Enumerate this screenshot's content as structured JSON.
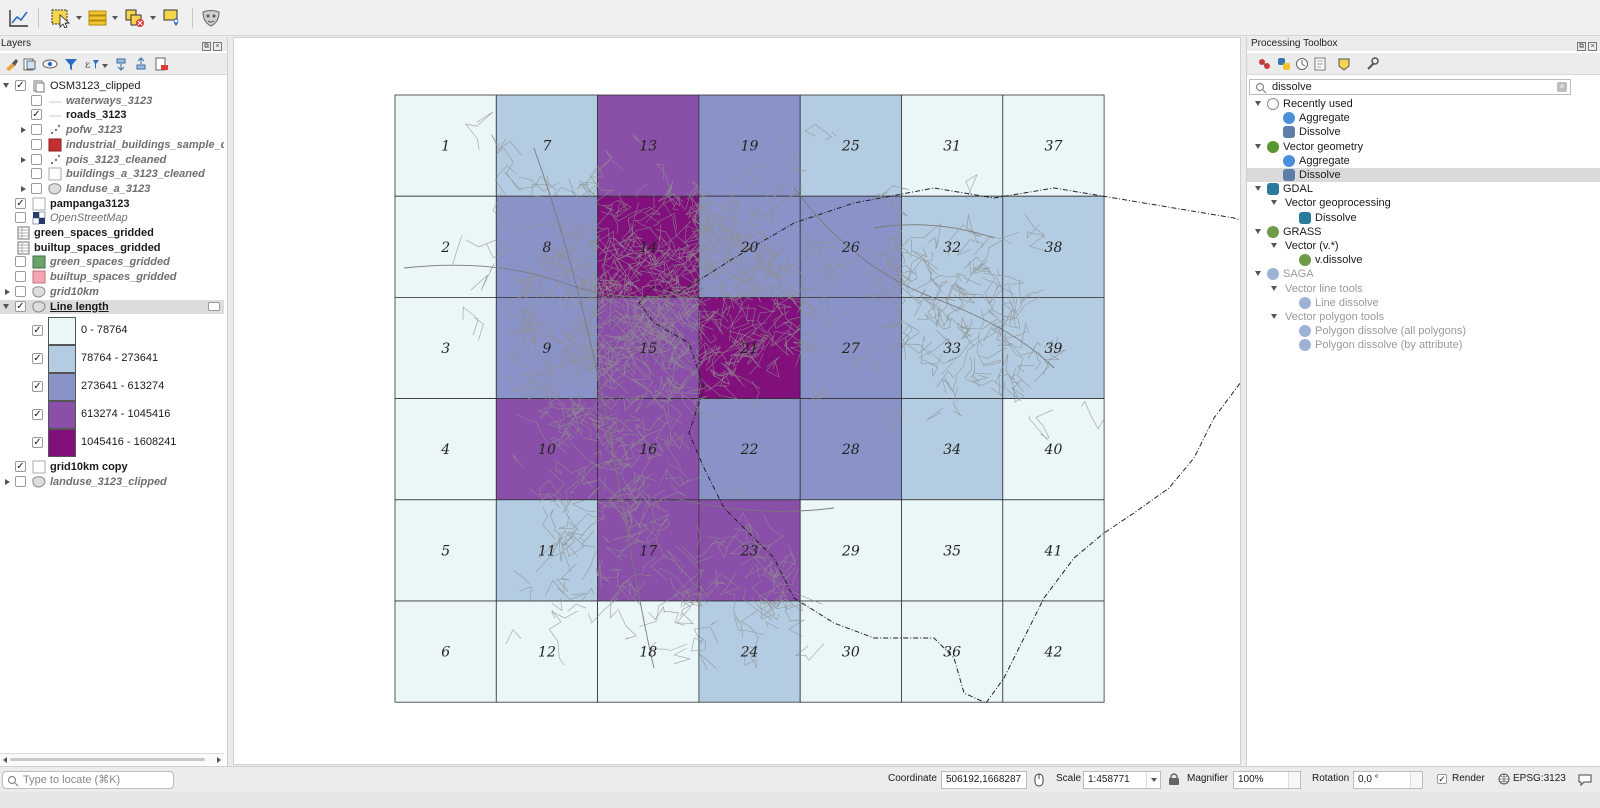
{
  "toolbar": {
    "icons": [
      "measure-graph-icon",
      "select-features-icon",
      "attribute-table-icon",
      "deselect-icon",
      "identify-icon",
      "plugin-mask-icon"
    ]
  },
  "layers": {
    "title": "Layers",
    "items": [
      {
        "name": "OSM3123_clipped",
        "checked": true,
        "style": "normal",
        "expand": "open",
        "indent": 0,
        "icon": "group-icon"
      },
      {
        "name": "waterways_3123",
        "checked": false,
        "style": "bi",
        "expand": "none",
        "indent": 1,
        "icon": "line-layer-icon"
      },
      {
        "name": "roads_3123",
        "checked": true,
        "style": "b",
        "expand": "none",
        "indent": 1,
        "icon": "line-layer-icon"
      },
      {
        "name": "pofw_3123",
        "checked": false,
        "style": "bi",
        "expand": "closed",
        "indent": 1,
        "icon": "point-layer-icon"
      },
      {
        "name": "industrial_buildings_sample_c",
        "checked": false,
        "style": "bi",
        "expand": "none",
        "indent": 1,
        "icon": "polygon-red-icon"
      },
      {
        "name": "pois_3123_cleaned",
        "checked": false,
        "style": "bi",
        "expand": "closed",
        "indent": 1,
        "icon": "point-layer-icon"
      },
      {
        "name": "buildings_a_3123_cleaned",
        "checked": false,
        "style": "bi",
        "expand": "none",
        "indent": 1,
        "icon": "polygon-white-icon"
      },
      {
        "name": "landuse_a_3123",
        "checked": false,
        "style": "bi",
        "expand": "closed",
        "indent": 1,
        "icon": "polygon-categorized-icon"
      },
      {
        "name": "pampanga3123",
        "checked": true,
        "style": "b",
        "expand": "none",
        "indent": 0,
        "icon": "polygon-white-icon"
      },
      {
        "name": "OpenStreetMap",
        "checked": false,
        "style": "i",
        "expand": "none",
        "indent": 0,
        "icon": "raster-tile-icon"
      },
      {
        "name": "green_spaces_gridded",
        "checked": null,
        "style": "b",
        "expand": "none",
        "indent": 0,
        "icon": "table-icon"
      },
      {
        "name": "builtup_spaces_gridded",
        "checked": null,
        "style": "b",
        "expand": "none",
        "indent": 0,
        "icon": "table-icon"
      },
      {
        "name": "green_spaces_gridded",
        "checked": false,
        "style": "bi",
        "expand": "none",
        "indent": 0,
        "icon": "polygon-green-icon"
      },
      {
        "name": "builtup_spaces_gridded",
        "checked": false,
        "style": "bi",
        "expand": "none",
        "indent": 0,
        "icon": "polygon-pink-icon"
      },
      {
        "name": "grid10km",
        "checked": false,
        "style": "bi",
        "expand": "closed",
        "indent": 0,
        "icon": "polygon-categorized-icon"
      },
      {
        "name": "Line length",
        "checked": true,
        "style": "u",
        "expand": "open",
        "indent": 0,
        "icon": "polygon-categorized-icon"
      }
    ],
    "legend": [
      {
        "label": "0 - 78764",
        "color": "#eaf6f8",
        "checked": true
      },
      {
        "label": "78764 - 273641",
        "color": "#b3cce1",
        "checked": true
      },
      {
        "label": "273641 - 613274",
        "color": "#8a93c8",
        "checked": true
      },
      {
        "label": "613274 - 1045416",
        "color": "#8a4fa8",
        "checked": true
      },
      {
        "label": "1045416 - 1608241",
        "color": "#810f7c",
        "checked": true
      }
    ],
    "items_after": [
      {
        "name": "grid10km copy",
        "checked": true,
        "style": "b",
        "expand": "none",
        "indent": 0,
        "icon": "polygon-white-icon"
      },
      {
        "name": "landuse_3123_clipped",
        "checked": false,
        "style": "bi",
        "expand": "closed",
        "indent": 0,
        "icon": "polygon-categorized-icon"
      }
    ]
  },
  "map": {
    "grid_columns": 7,
    "grid_rows": 6,
    "cell_ids": [
      [
        1,
        7,
        13,
        19,
        25,
        31,
        37
      ],
      [
        2,
        8,
        14,
        20,
        26,
        32,
        38
      ],
      [
        3,
        9,
        15,
        21,
        27,
        33,
        39
      ],
      [
        4,
        10,
        16,
        22,
        28,
        34,
        40
      ],
      [
        5,
        11,
        17,
        23,
        29,
        35,
        41
      ],
      [
        6,
        12,
        18,
        24,
        30,
        36,
        42
      ]
    ],
    "cell_class": [
      [
        0,
        1,
        3,
        2,
        1,
        0,
        0
      ],
      [
        0,
        2,
        4,
        2,
        2,
        1,
        1
      ],
      [
        0,
        2,
        3,
        4,
        2,
        1,
        1
      ],
      [
        0,
        3,
        3,
        2,
        2,
        1,
        0
      ],
      [
        0,
        1,
        3,
        3,
        0,
        0,
        0
      ],
      [
        0,
        0,
        0,
        1,
        0,
        0,
        0
      ]
    ],
    "class_colors": [
      "#eaf6f8",
      "#b3cce1",
      "#8a93c8",
      "#8a4fa8",
      "#810f7c"
    ]
  },
  "toolbox": {
    "title": "Processing Toolbox",
    "search_value": "dissolve",
    "items": [
      {
        "label": "Recently used",
        "level": 0,
        "expand": "open",
        "icon": "clock-icon",
        "dim": false,
        "selected": false
      },
      {
        "label": "Aggregate",
        "level": 1,
        "expand": "none",
        "icon": "gear-icon",
        "dim": false,
        "selected": false
      },
      {
        "label": "Dissolve",
        "level": 1,
        "expand": "none",
        "icon": "dissolve-icon",
        "dim": false,
        "selected": false
      },
      {
        "label": "Vector geometry",
        "level": 0,
        "expand": "open",
        "icon": "qgis-icon",
        "dim": false,
        "selected": false
      },
      {
        "label": "Aggregate",
        "level": 1,
        "expand": "none",
        "icon": "gear-icon",
        "dim": false,
        "selected": false
      },
      {
        "label": "Dissolve",
        "level": 1,
        "expand": "none",
        "icon": "dissolve-icon",
        "dim": false,
        "selected": true
      },
      {
        "label": "GDAL",
        "level": 0,
        "expand": "open",
        "icon": "gdal-icon",
        "dim": false,
        "selected": false
      },
      {
        "label": "Vector geoprocessing",
        "level": 1,
        "expand": "open",
        "icon": "",
        "dim": false,
        "selected": false
      },
      {
        "label": "Dissolve",
        "level": 2,
        "expand": "none",
        "icon": "gdal-icon",
        "dim": false,
        "selected": false
      },
      {
        "label": "GRASS",
        "level": 0,
        "expand": "open",
        "icon": "grass-icon",
        "dim": false,
        "selected": false
      },
      {
        "label": "Vector (v.*)",
        "level": 1,
        "expand": "open",
        "icon": "",
        "dim": false,
        "selected": false
      },
      {
        "label": "v.dissolve",
        "level": 2,
        "expand": "none",
        "icon": "grass-icon",
        "dim": false,
        "selected": false
      },
      {
        "label": "SAGA",
        "level": 0,
        "expand": "open",
        "icon": "saga-icon",
        "dim": true,
        "selected": false
      },
      {
        "label": "Vector line tools",
        "level": 1,
        "expand": "open",
        "icon": "",
        "dim": true,
        "selected": false
      },
      {
        "label": "Line dissolve",
        "level": 2,
        "expand": "none",
        "icon": "saga-icon",
        "dim": true,
        "selected": false
      },
      {
        "label": "Vector polygon tools",
        "level": 1,
        "expand": "open",
        "icon": "",
        "dim": true,
        "selected": false
      },
      {
        "label": "Polygon dissolve (all polygons)",
        "level": 2,
        "expand": "none",
        "icon": "saga-icon",
        "dim": true,
        "selected": false
      },
      {
        "label": "Polygon dissolve (by attribute)",
        "level": 2,
        "expand": "none",
        "icon": "saga-icon",
        "dim": true,
        "selected": false
      }
    ]
  },
  "status": {
    "locator_placeholder": "Type to locate (⌘K)",
    "coordinate_label": "Coordinate",
    "coordinate_value": "506192,1668287",
    "scale_label": "Scale",
    "scale_value": "1:458771",
    "magnifier_label": "Magnifier",
    "magnifier_value": "100%",
    "rotation_label": "Rotation",
    "rotation_value": "0,0 °",
    "render_label": "Render",
    "render_checked": true,
    "crs_label": "EPSG:3123"
  }
}
